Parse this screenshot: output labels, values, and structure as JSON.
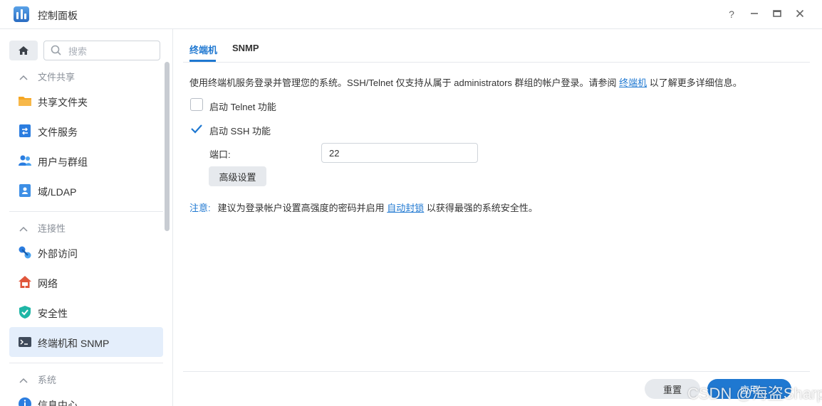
{
  "window": {
    "title": "控制面板"
  },
  "sidebar": {
    "search_placeholder": "搜索",
    "groups": [
      {
        "label": "文件共享"
      },
      {
        "label": "连接性"
      },
      {
        "label": "系统"
      }
    ],
    "items": [
      {
        "label": "共享文件夹",
        "icon": "shared-folder-icon"
      },
      {
        "label": "文件服务",
        "icon": "file-services-icon"
      },
      {
        "label": "用户与群组",
        "icon": "users-icon"
      },
      {
        "label": "域/LDAP",
        "icon": "domain-icon"
      },
      {
        "label": "外部访问",
        "icon": "external-access-icon"
      },
      {
        "label": "网络",
        "icon": "network-icon"
      },
      {
        "label": "安全性",
        "icon": "security-icon"
      },
      {
        "label": "终端机和 SNMP",
        "icon": "terminal-icon"
      },
      {
        "label": "信息中心",
        "icon": "info-center-icon"
      }
    ],
    "selected_index": 7
  },
  "tabs": [
    {
      "label": "终端机",
      "active": true
    },
    {
      "label": "SNMP",
      "active": false
    }
  ],
  "content": {
    "desc_before": "使用终端机服务登录并管理您的系统。SSH/Telnet 仅支持从属于 administrators 群组的帐户登录。请参阅 ",
    "desc_link": "终端机",
    "desc_after": " 以了解更多详细信息。",
    "telnet_label": "启动 Telnet 功能",
    "telnet_checked": false,
    "ssh_label": "启动 SSH 功能",
    "ssh_checked": true,
    "port_label": "端口:",
    "port_value": "22",
    "advanced_button": "高级设置",
    "note_label": "注意:",
    "note_before": "建议为登录帐户设置高强度的密码并启用 ",
    "note_link": "自动封锁",
    "note_after": " 以获得最强的系统安全性。"
  },
  "footer": {
    "reset_label": "重置",
    "apply_label": "应用"
  },
  "watermark": "CSDN @海盗Sharp",
  "colors": {
    "accent": "#1f78d1",
    "selected_bg": "#e4eefb"
  }
}
